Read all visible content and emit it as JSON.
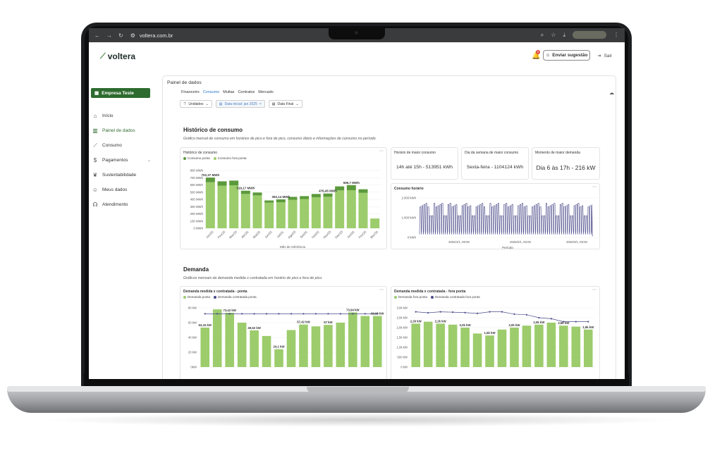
{
  "browser": {
    "url": "voltera.com.br"
  },
  "header": {
    "logo_text": "voltera",
    "notification_count": "8",
    "suggest_label": "Enviar sugestão",
    "logout_label": "Sair"
  },
  "sidebar": {
    "company": "Empresa Teste",
    "items": [
      {
        "label": "Início",
        "icon": "home-icon"
      },
      {
        "label": "Painel de dados",
        "icon": "chart-icon"
      },
      {
        "label": "Consumo",
        "icon": "line-chart-icon"
      },
      {
        "label": "Pagamentos",
        "icon": "money-icon"
      },
      {
        "label": "Sustentabilidade",
        "icon": "leaf-icon"
      },
      {
        "label": "Meus dados",
        "icon": "user-icon"
      },
      {
        "label": "Atendimento",
        "icon": "headset-icon"
      }
    ]
  },
  "panel": {
    "title": "Painel de dados",
    "tabs": [
      "Financeiro",
      "Consumo",
      "Multas",
      "Contratos",
      "Mercado"
    ],
    "active_tab": "Consumo",
    "filters": {
      "unidades": "Unidades",
      "data_inicial": "Data inicial: jan 2025",
      "data_final": "Data Final"
    }
  },
  "historico": {
    "title": "Histórico de consumo",
    "subtitle": "Gráfico mensal de consumo em horários de pico e fora de pico, consumo diário e informações de consumo no período."
  },
  "kpis": [
    {
      "label": "Horário de maior consumo",
      "value": "14h até 15h - 513951 kWh"
    },
    {
      "label": "Dia da semana de maior consumo",
      "value": "Sexta-feira - 1104124 kWh"
    },
    {
      "label": "Momento de maior demanda",
      "value": "Dia 6 às 17h - 216 kW"
    }
  ],
  "demanda": {
    "title": "Demanda",
    "subtitle": "Gráficos mensais da demanda medida x contratada em horário de pico e fora de pico."
  },
  "colors": {
    "accent_green": "#2e6b2f",
    "bar_dark": "#5b9a3c",
    "bar_light": "#9ccc6c",
    "line": "#4a4a8a",
    "tab_active": "#2a78c8"
  },
  "chart_data": [
    {
      "type": "bar",
      "title": "Histórico de consumo",
      "xlabel": "Mês de referência",
      "ylabel": "",
      "ylim": [
        0,
        800
      ],
      "yticks": [
        "0 MWh",
        "100 MWh",
        "200 MWh",
        "300 MWh",
        "400 MWh",
        "500 MWh",
        "600 MWh",
        "700 MWh",
        "800 MWh"
      ],
      "categories": [
        "Jan/25",
        "Fev/25",
        "Mar/25",
        "Abr/25",
        "Mai/25",
        "Jun/25",
        "Jul/25",
        "Ago/25",
        "Set/25",
        "Out/25",
        "Nov/25",
        "Dez/25",
        "Jan/26",
        "Fev/26",
        "Mar/26"
      ],
      "series": [
        {
          "name": "Consumo ponta",
          "values": [
            65,
            60,
            65,
            45,
            40,
            30,
            40,
            40,
            40,
            45,
            45,
            55,
            70,
            50,
            0
          ]
        },
        {
          "name": "Consumo fora ponta",
          "values": [
            637,
            590,
            595,
            475,
            455,
            355,
            360,
            395,
            405,
            430,
            436,
            525,
            527,
            490,
            135
          ]
        }
      ],
      "data_labels": [
        "702,37 MWh",
        "519,17 MWh",
        "392,14 MWh",
        "476,45 MWh",
        "596,7 MWh"
      ]
    },
    {
      "type": "line",
      "title": "Consumo horário",
      "xlabel": "Período",
      "ylim": [
        0,
        2000
      ],
      "yticks": [
        "0 kWh",
        "1.000 kWh",
        "2.000 kWh"
      ],
      "xticks": [
        "2026/1/1, 00:00",
        "2026/2/1, 00:00",
        "2026/3/1, 00:00"
      ]
    },
    {
      "type": "bar",
      "title": "Demanda medida x contratada - ponta",
      "ylim": [
        0,
        80
      ],
      "yticks": [
        "0kW",
        "20 kW",
        "40 kW",
        "60 kW",
        "80 kW"
      ],
      "categories": [
        "Jan/25",
        "Fev/25",
        "Mar/25",
        "Abr/25",
        "Mai/25",
        "Jun/25",
        "Jul/25",
        "Ago/25",
        "Set/25",
        "Out/25",
        "Nov/25",
        "Dez/25",
        "Jan/26",
        "Fev/26",
        "Mar/26"
      ],
      "series": [
        {
          "name": "Demanda ponta",
          "values": [
            53.34,
            78,
            73.42,
            60,
            49.62,
            42,
            24.1,
            50,
            57.42,
            55,
            57,
            60,
            73.94,
            69,
            69.06
          ]
        },
        {
          "name": "Demanda contratada ponta",
          "values": [
            72,
            72,
            72,
            72,
            72,
            72,
            72,
            72,
            72,
            72,
            72,
            72,
            72,
            72,
            72
          ]
        }
      ],
      "data_labels": [
        "53,34 kW",
        "73,42 kW",
        "49,62 kW",
        "24,1 kW",
        "57,42 kW",
        "57 kW",
        "73,94 kW",
        "69,06 kW"
      ]
    },
    {
      "type": "bar",
      "title": "Demanda medida x contratada - fora ponta",
      "ylim": [
        0,
        3000
      ],
      "yticks": [
        "0 kW",
        "500 kW",
        "1,0k kW",
        "1,5k kW",
        "2,0k kW",
        "2,5k kW",
        "3,0k kW"
      ],
      "categories": [
        "Jan/25",
        "Fev/25",
        "Mar/25",
        "Abr/25",
        "Mai/25",
        "Jun/25",
        "Jul/25",
        "Ago/25",
        "Set/25",
        "Out/25",
        "Nov/25",
        "Dez/25",
        "Jan/26",
        "Fev/26",
        "Mar/26"
      ],
      "series": [
        {
          "name": "Demanda fora ponta",
          "values": [
            2200,
            2300,
            2200,
            2150,
            2000,
            1700,
            1600,
            1900,
            2000,
            2100,
            2150,
            2250,
            2100,
            2050,
            1900
          ]
        },
        {
          "name": "Demanda contratada fora ponta",
          "values": [
            2800,
            2750,
            2800,
            2780,
            2760,
            2720,
            2800,
            2800,
            2680,
            2650,
            2500,
            2450,
            2300,
            2300,
            2300
          ]
        }
      ],
      "data_labels": [
        "2,2k kW",
        "2,2k kW",
        "2,0k kW",
        "1,6k kW",
        "2,0k kW",
        "2,5k kW",
        "2,5k kW",
        "1,9k kW"
      ]
    }
  ]
}
